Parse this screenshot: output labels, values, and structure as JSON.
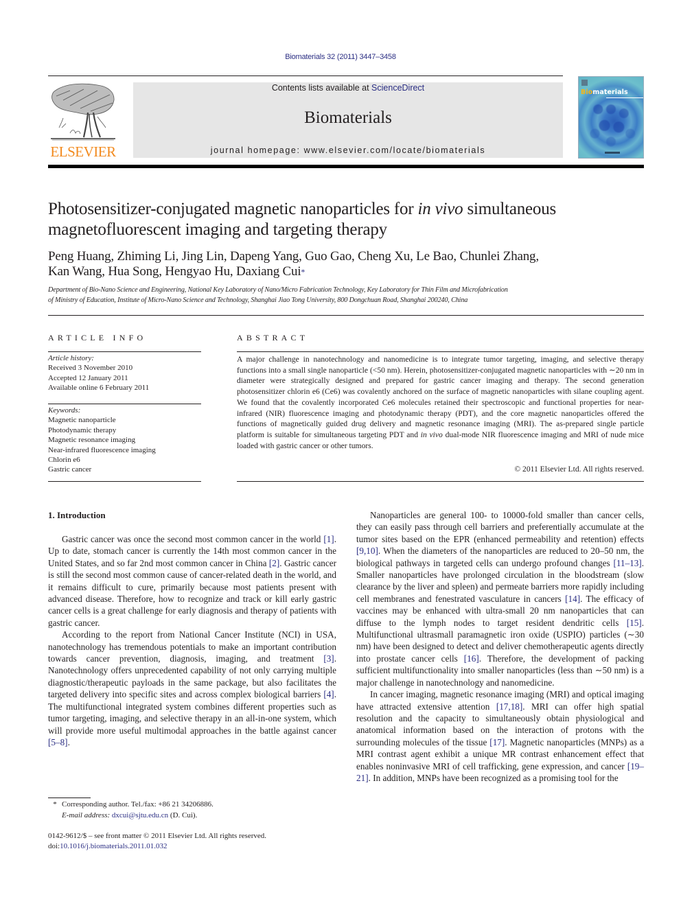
{
  "header": {
    "citation": "Biomaterials 32 (2011) 3447–3458",
    "contents_prefix": "Contents lists available at ",
    "contents_link": "ScienceDirect",
    "journal_name": "Biomaterials",
    "homepage": "journal homepage: www.elsevier.com/locate/biomaterials",
    "publisher_logo": "ELSEVIER",
    "cover": {
      "title_accent": "Bio",
      "title_rest": "materials",
      "accent_color": "#f2b31a"
    }
  },
  "colors": {
    "link": "#2b2e83",
    "publisher_orange": "#f28a1e",
    "header_box": "#e6e6e6"
  },
  "article": {
    "title_part1": "Photosensitizer-conjugated magnetic nanoparticles for ",
    "title_italic": "in vivo",
    "title_part2": " simultaneous magnetofluorescent imaging and targeting therapy",
    "authors_line1": "Peng Huang, Zhiming Li, Jing Lin, Dapeng Yang, Guo Gao, Cheng Xu, Le Bao, Chunlei Zhang,",
    "authors_line2": "Kan Wang, Hua Song, Hengyao Hu, Daxiang Cui",
    "corresponding_mark": "*",
    "affiliation_line1": "Department of Bio-Nano Science and Engineering, National Key Laboratory of Nano/Micro Fabrication Technology, Key Laboratory for Thin Film and Microfabrication",
    "affiliation_line2": "of Ministry of Education, Institute of Micro-Nano Science and Technology, Shanghai Jiao Tong University, 800 Dongchuan Road, Shanghai 200240, China"
  },
  "article_info": {
    "heading": "ARTICLE INFO",
    "history_label": "Article history:",
    "history": [
      "Received 3 November 2010",
      "Accepted 12 January 2011",
      "Available online 6 February 2011"
    ],
    "keywords_label": "Keywords:",
    "keywords": [
      "Magnetic nanoparticle",
      "Photodynamic therapy",
      "Magnetic resonance imaging",
      "Near-infrared fluorescence imaging",
      "Chlorin e6",
      "Gastric cancer"
    ]
  },
  "abstract": {
    "heading": "ABSTRACT",
    "text_part1": "A major challenge in nanotechnology and nanomedicine is to integrate tumor targeting, imaging, and selective therapy functions into a small single nanoparticle (<50 nm). Herein, photosensitizer-conjugated magnetic nanoparticles with ∼20 nm in diameter were strategically designed and prepared for gastric cancer imaging and therapy. The second generation photosensitizer chlorin e6 (Ce6) was covalently anchored on the surface of magnetic nanoparticles with silane coupling agent. We found that the covalently incorporated Ce6 molecules retained their spectroscopic and functional properties for near-infrared (NIR) fluorescence imaging and photodynamic therapy (PDT), and the core magnetic nanoparticles offered the functions of magnetically guided drug delivery and magnetic resonance imaging (MRI). The as-prepared single particle platform is suitable for simultaneous targeting PDT and ",
    "text_italic": "in vivo",
    "text_part2": " dual-mode NIR fluorescence imaging and MRI of nude mice loaded with gastric cancer or other tumors.",
    "copyright": "© 2011 Elsevier Ltd. All rights reserved."
  },
  "introduction": {
    "heading": "1.  Introduction",
    "left_paragraphs": [
      [
        {
          "t": "Gastric cancer was once the second most common cancer in the world "
        },
        {
          "ref": "[1]"
        },
        {
          "t": ". Up to date, stomach cancer is currently the 14th most common cancer in the United States, and so far 2nd most common cancer in China "
        },
        {
          "ref": "[2]"
        },
        {
          "t": ". Gastric cancer is still the second most common cause of cancer-related death in the world, and it remains difficult to cure, primarily because most patients present with advanced disease. Therefore, how to recognize and track or kill early gastric cancer cells is a great challenge for early diagnosis and therapy of patients with gastric cancer."
        }
      ],
      [
        {
          "t": "According to the report from National Cancer Institute (NCI) in USA, nanotechnology has tremendous potentials to make an important contribution towards cancer prevention, diagnosis, imaging, and treatment "
        },
        {
          "ref": "[3]"
        },
        {
          "t": ". Nanotechnology offers unprecedented capability of not only carrying multiple diagnostic/therapeutic payloads in the same package, but also facilitates the targeted delivery into specific sites and across complex biological barriers "
        },
        {
          "ref": "[4]"
        },
        {
          "t": ". The multifunctional integrated system combines different properties such as tumor targeting, imaging, and selective therapy in an all-in-one system, which will provide more useful multimodal approaches in the battle against cancer "
        },
        {
          "ref": "[5–8]"
        },
        {
          "t": "."
        }
      ]
    ],
    "right_paragraphs": [
      [
        {
          "t": "Nanoparticles are general 100- to 10000-fold smaller than cancer cells, they can easily pass through cell barriers and preferentially accumulate at the tumor sites based on the EPR (enhanced permeability and retention) effects "
        },
        {
          "ref": "[9,10]"
        },
        {
          "t": ". When the diameters of the nanoparticles are reduced to 20–50 nm, the biological pathways in targeted cells can undergo profound changes "
        },
        {
          "ref": "[11–13]"
        },
        {
          "t": ". Smaller nanoparticles have prolonged circulation in the bloodstream (slow clearance by the liver and spleen) and permeate barriers more rapidly including cell membranes and fenestrated vasculature in cancers "
        },
        {
          "ref": "[14]"
        },
        {
          "t": ". The efficacy of vaccines may be enhanced with ultra-small 20 nm nanoparticles that can diffuse to the lymph nodes to target resident dendritic cells "
        },
        {
          "ref": "[15]"
        },
        {
          "t": ". Multifunctional ultrasmall paramagnetic iron oxide (USPIO) particles (∼30 nm) have been designed to detect and deliver chemotherapeutic agents directly into prostate cancer cells "
        },
        {
          "ref": "[16]"
        },
        {
          "t": ". Therefore, the development of packing sufficient multifunctionality into smaller nanoparticles (less than ∼50 nm) is a major challenge in nanotechnology and nanomedicine."
        }
      ],
      [
        {
          "t": "In cancer imaging, magnetic resonance imaging (MRI) and optical imaging have attracted extensive attention "
        },
        {
          "ref": "[17,18]"
        },
        {
          "t": ". MRI can offer high spatial resolution and the capacity to simultaneously obtain physiological and anatomical information based on the interaction of protons with the surrounding molecules of the tissue "
        },
        {
          "ref": "[17]"
        },
        {
          "t": ". Magnetic nanoparticles (MNPs) as a MRI contrast agent exhibit a unique MR contrast enhancement effect that enables noninvasive MRI of cell trafficking, gene expression, and cancer "
        },
        {
          "ref": "[19–21]"
        },
        {
          "t": ". In addition, MNPs have been recognized as a promising tool for the"
        }
      ]
    ]
  },
  "footnote": {
    "star": "*",
    "corresponding": "Corresponding author. Tel./fax: +86 21 34206886.",
    "email_label": "E-mail address:",
    "email": "dxcui@sjtu.edu.cn",
    "email_suffix": " (D. Cui)."
  },
  "front_matter": {
    "issn_line": "0142-9612/$ – see front matter © 2011 Elsevier Ltd. All rights reserved.",
    "doi_prefix": "doi:",
    "doi": "10.1016/j.biomaterials.2011.01.032"
  }
}
